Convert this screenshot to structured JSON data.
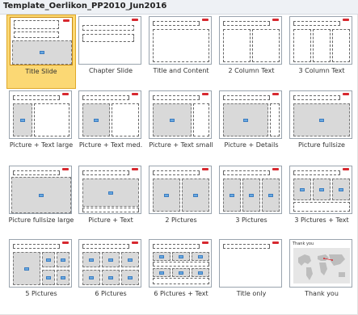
{
  "header": {
    "title": "Template_Oerlikon_PP2010_Jun2016"
  },
  "layouts": [
    {
      "label": "Title Slide",
      "selected": true,
      "kind": "title-slide"
    },
    {
      "label": "Chapter Slide",
      "selected": false,
      "kind": "chapter-slide"
    },
    {
      "label": "Title and Content",
      "selected": false,
      "kind": "title-content"
    },
    {
      "label": "2 Column Text",
      "selected": false,
      "kind": "two-col"
    },
    {
      "label": "3 Column Text",
      "selected": false,
      "kind": "three-col"
    },
    {
      "label": "Picture + Text large",
      "selected": false,
      "kind": "pic-text-large"
    },
    {
      "label": "Picture + Text med.",
      "selected": false,
      "kind": "pic-text-med"
    },
    {
      "label": "Picture + Text small",
      "selected": false,
      "kind": "pic-text-small"
    },
    {
      "label": "Picture + Details",
      "selected": false,
      "kind": "pic-details"
    },
    {
      "label": "Picture fullsize",
      "selected": false,
      "kind": "pic-full"
    },
    {
      "label": "Picture fullsize large",
      "selected": false,
      "kind": "pic-full-large"
    },
    {
      "label": "Picture + Text",
      "selected": false,
      "kind": "pic-text"
    },
    {
      "label": "2 Pictures",
      "selected": false,
      "kind": "two-pics"
    },
    {
      "label": "3 Pictures",
      "selected": false,
      "kind": "three-pics"
    },
    {
      "label": "3 Pictures + Text",
      "selected": false,
      "kind": "three-pics-text"
    },
    {
      "label": "5 Pictures",
      "selected": false,
      "kind": "five-pics"
    },
    {
      "label": "6 Pictures",
      "selected": false,
      "kind": "six-pics"
    },
    {
      "label": "6 Pictures + Text",
      "selected": false,
      "kind": "six-pics-text"
    },
    {
      "label": "Title only",
      "selected": false,
      "kind": "title-only"
    },
    {
      "label": "Thank you",
      "selected": false,
      "kind": "thank-you",
      "thumb_text": "Thank you"
    }
  ],
  "colors": {
    "selected_fill": "#fbd874",
    "selected_border": "#e0a928",
    "logo_red": "#d7282f",
    "picture_fill": "#d9d9d9"
  }
}
